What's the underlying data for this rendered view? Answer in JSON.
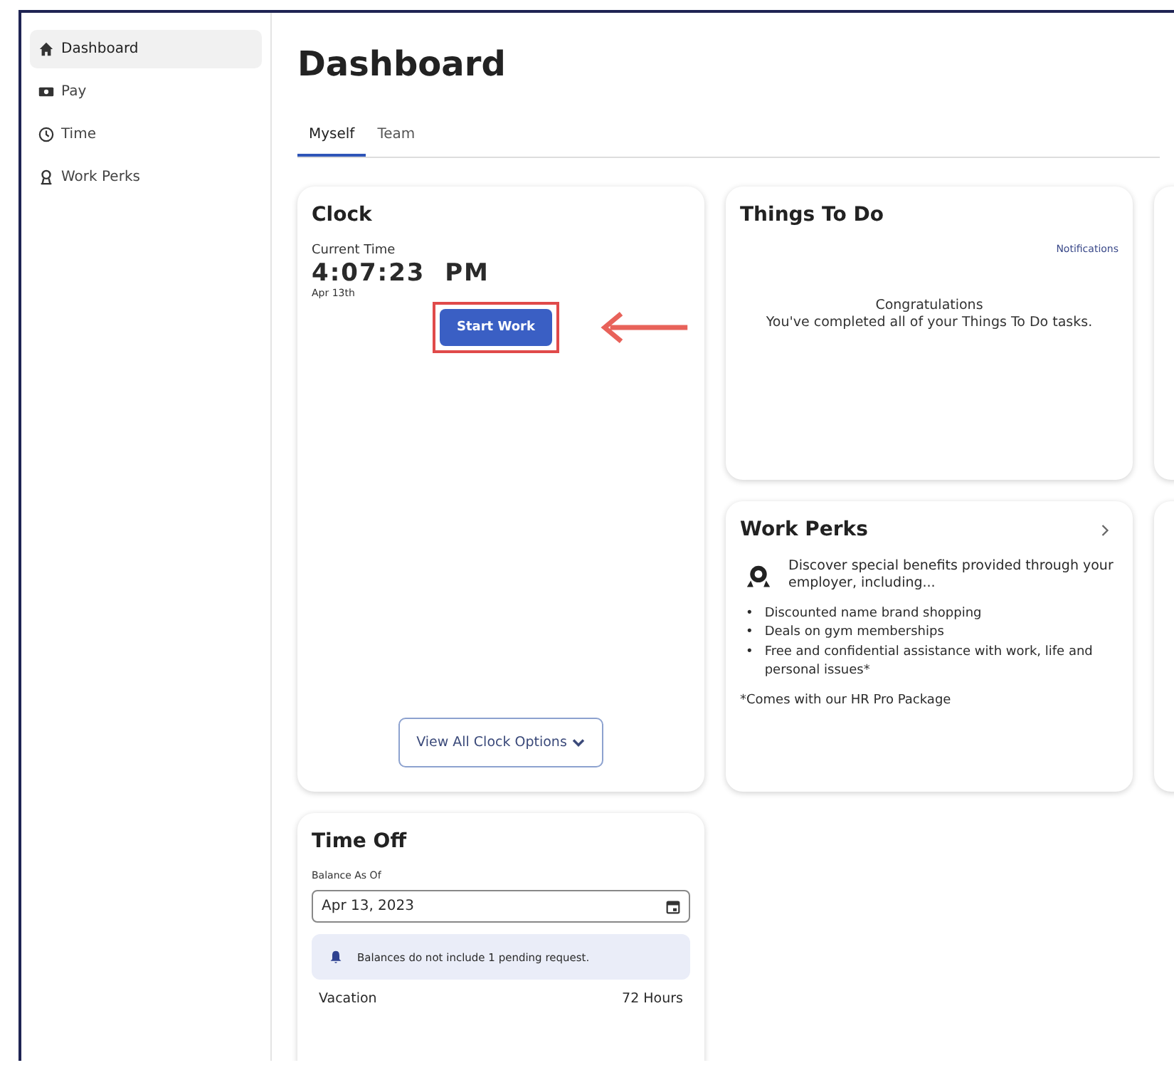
{
  "sidebar": {
    "items": [
      {
        "label": "Dashboard",
        "selected": true
      },
      {
        "label": "Pay",
        "selected": false
      },
      {
        "label": "Time",
        "selected": false
      },
      {
        "label": "Work Perks",
        "selected": false
      }
    ]
  },
  "page_title": "Dashboard",
  "tabs": [
    {
      "label": "Myself",
      "selected": true
    },
    {
      "label": "Team",
      "selected": false
    }
  ],
  "clock": {
    "title": "Clock",
    "label": "Current Time",
    "time": "4:07:23  PM",
    "date": "Apr 13th",
    "start_button": "Start Work",
    "highlighted": true,
    "options_button": "View All Clock Options"
  },
  "things_to_do": {
    "title": "Things To Do",
    "link": "Notifications",
    "heading": "Congratulations",
    "message": "You've completed all of your Things To Do tasks."
  },
  "work_perks": {
    "title": "Work Perks",
    "intro": "Discover special benefits provided through your employer, including...",
    "items": [
      {
        "bullet": "•",
        "text": "Discounted name brand shopping"
      },
      {
        "bullet": "•",
        "text": "Deals on gym memberships"
      },
      {
        "bullet": "•",
        "text": "Free and confidential assistance with work, life and personal issues*"
      }
    ],
    "footnote": "*Comes with our HR Pro Package"
  },
  "time_off": {
    "title": "Time Off",
    "date_label": "Balance As Of",
    "date_value": "Apr 13, 2023",
    "notice": "Balances do not include 1 pending request.",
    "balances": [
      {
        "type": "Vacation",
        "amount": "72 Hours"
      }
    ]
  }
}
